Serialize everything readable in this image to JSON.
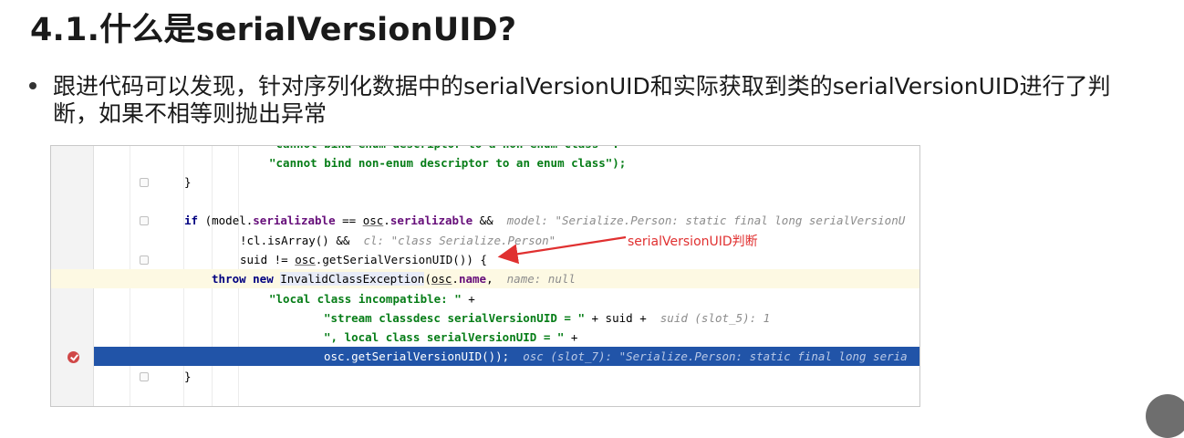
{
  "slide": {
    "title": "4.1.什么是serialVersionUID?",
    "watermark": "",
    "bullet": "跟进代码可以发现，针对序列化数据中的serialVersionUID和实际获取到类的serialVersionUID进行了判断，如果不相等则抛出异常"
  },
  "annotation": {
    "label": "serialVersionUID判断",
    "color": "#e03030"
  },
  "code": {
    "lines": [
      {
        "parts": [
          "\"cannot bind non-enum descriptor to an enum class\");"
        ]
      },
      {
        "parts": [
          "}"
        ]
      },
      {
        "parts": [
          "if",
          " (model.",
          "serializable",
          " == ",
          "osc",
          ".",
          "serializable",
          " &&  ",
          "model: \"Serialize.Person: static final long serialVersionU"
        ]
      },
      {
        "parts": [
          "!cl.isArray() &&  ",
          "cl: \"class Serialize.Person\""
        ]
      },
      {
        "parts": [
          "suid != ",
          "osc",
          ".getSerialVersionUID()) {"
        ]
      },
      {
        "parts": [
          "throw new",
          " ",
          "InvalidClassException",
          "(",
          "osc",
          ".",
          "name",
          ",  ",
          "name: null"
        ]
      },
      {
        "parts": [
          "\"local class incompatible: \"",
          " +"
        ]
      },
      {
        "parts": [
          "\"stream classdesc serialVersionUID = \"",
          " + suid +  ",
          "suid (slot_5): 1"
        ]
      },
      {
        "parts": [
          "\", local class serialVersionUID = \"",
          " +"
        ]
      },
      {
        "parts": [
          "osc",
          ".getSerialVersionUID());  ",
          "osc (slot_7): \"Serialize.Person: static final long seria"
        ]
      },
      {
        "parts": [
          "}"
        ]
      }
    ]
  },
  "colors": {
    "keyword": "#000080",
    "string": "#067d17",
    "field": "#660e7a",
    "hint": "#8c8c8c",
    "current_line": "#2154a8",
    "exec_line": "#fdf9e3",
    "breakpoint": "#d04848"
  },
  "icons": {
    "breakpoint": "breakpoint-check-icon",
    "fold": "fold-marker-icon"
  }
}
